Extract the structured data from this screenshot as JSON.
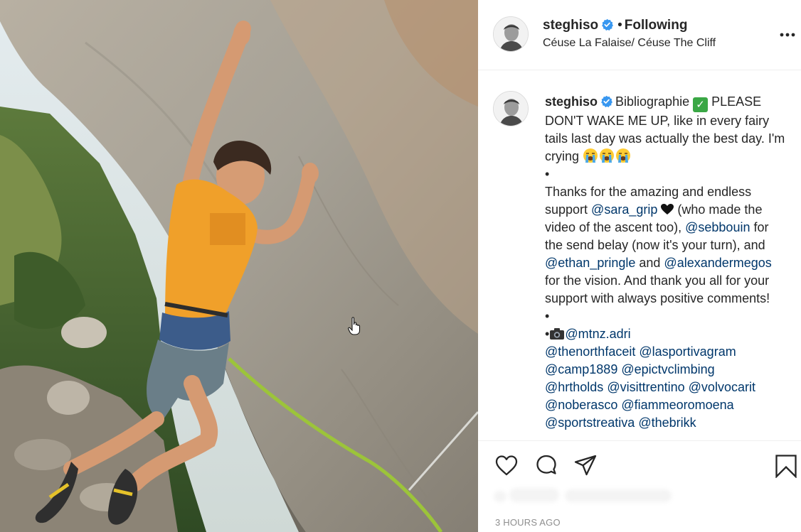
{
  "photo": {
    "alt_subject": "climber-on-overhanging-rock-face",
    "shirt_logo_text": "THE NORTH FACE"
  },
  "header": {
    "username": "steghiso",
    "separator": "•",
    "follow_status": "Following",
    "location": "Céuse La Falaise/ Céuse The Cliff",
    "more_icon": "more-horizontal-icon"
  },
  "caption": {
    "username": "steghiso",
    "p1a": "Bibliographie ",
    "p1b": " PLEASE DON'T WAKE ME UP, like in every fairy tails last day was actually the best day. I'm crying ",
    "bullet1": "•",
    "p2a": "Thanks for the amazing and endless support ",
    "mention_sara": "@sara_grip",
    "p2b": " (who made the video of the ascent too), ",
    "mention_sebbouin": "@sebbouin",
    "p2c": " for the send belay (now it's your turn), and ",
    "mention_ethan": "@ethan_pringle",
    "p2d": " and ",
    "mention_alexander": "@alexandermegos",
    "p2e": " for the vision. And thank you all for your support with always positive comments!",
    "bullet2": "•",
    "bullet3": "•",
    "mention_mtnz": "@mtnz.adri",
    "tags": [
      "@thenorthfaceit",
      "@lasportivagram",
      "@camp1889",
      "@epictvclimbing",
      "@hrtholds",
      "@visittrentino",
      "@volvocarit",
      "@noberasco",
      "@fiammeoromoena",
      "@sportstreativa",
      "@thebrikk"
    ],
    "emojis": [
      "check-mark-emoji",
      "crying-face-emoji",
      "camera-emoji",
      "black-heart-emoji"
    ]
  },
  "actions": {
    "like_icon": "heart-icon",
    "comment_icon": "comment-icon",
    "share_icon": "paper-plane-icon",
    "save_icon": "bookmark-icon"
  },
  "timestamp": "3 HOURS AGO",
  "colors": {
    "mention": "#00376b",
    "text": "#262626",
    "secondary": "#8e8e8e",
    "verified": "#3897f0",
    "divider": "#efefef"
  }
}
